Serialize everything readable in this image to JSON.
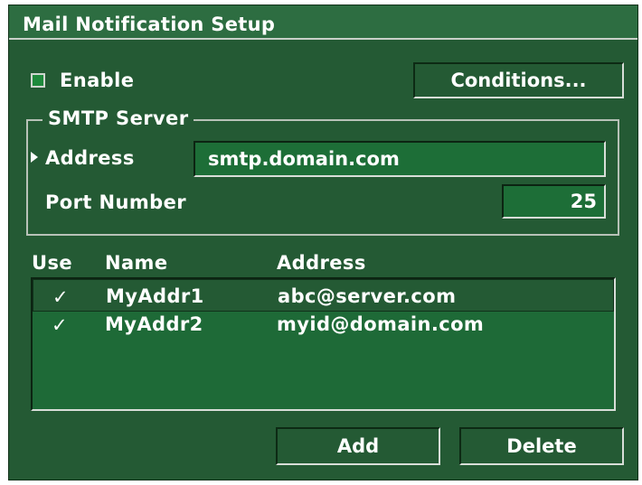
{
  "window": {
    "title": "Mail Notification Setup"
  },
  "enable": {
    "label": "Enable",
    "checked": false
  },
  "conditions_button": {
    "label": "Conditions..."
  },
  "smtp": {
    "legend": "SMTP Server",
    "address_label": "Address",
    "address_value": "smtp.domain.com",
    "port_label": "Port Number",
    "port_value": "25"
  },
  "table": {
    "headers": {
      "use": "Use",
      "name": "Name",
      "address": "Address"
    },
    "rows": [
      {
        "use": "✓",
        "name": "MyAddr1",
        "address": "abc@server.com"
      },
      {
        "use": "✓",
        "name": "MyAddr2",
        "address": "myid@domain.com"
      }
    ]
  },
  "buttons": {
    "add": "Add",
    "delete": "Delete"
  },
  "colors": {
    "panel_bg": "#245a34",
    "field_bg": "#1d6e37",
    "title_bar": "#2d6d41",
    "text": "#ffffff"
  }
}
